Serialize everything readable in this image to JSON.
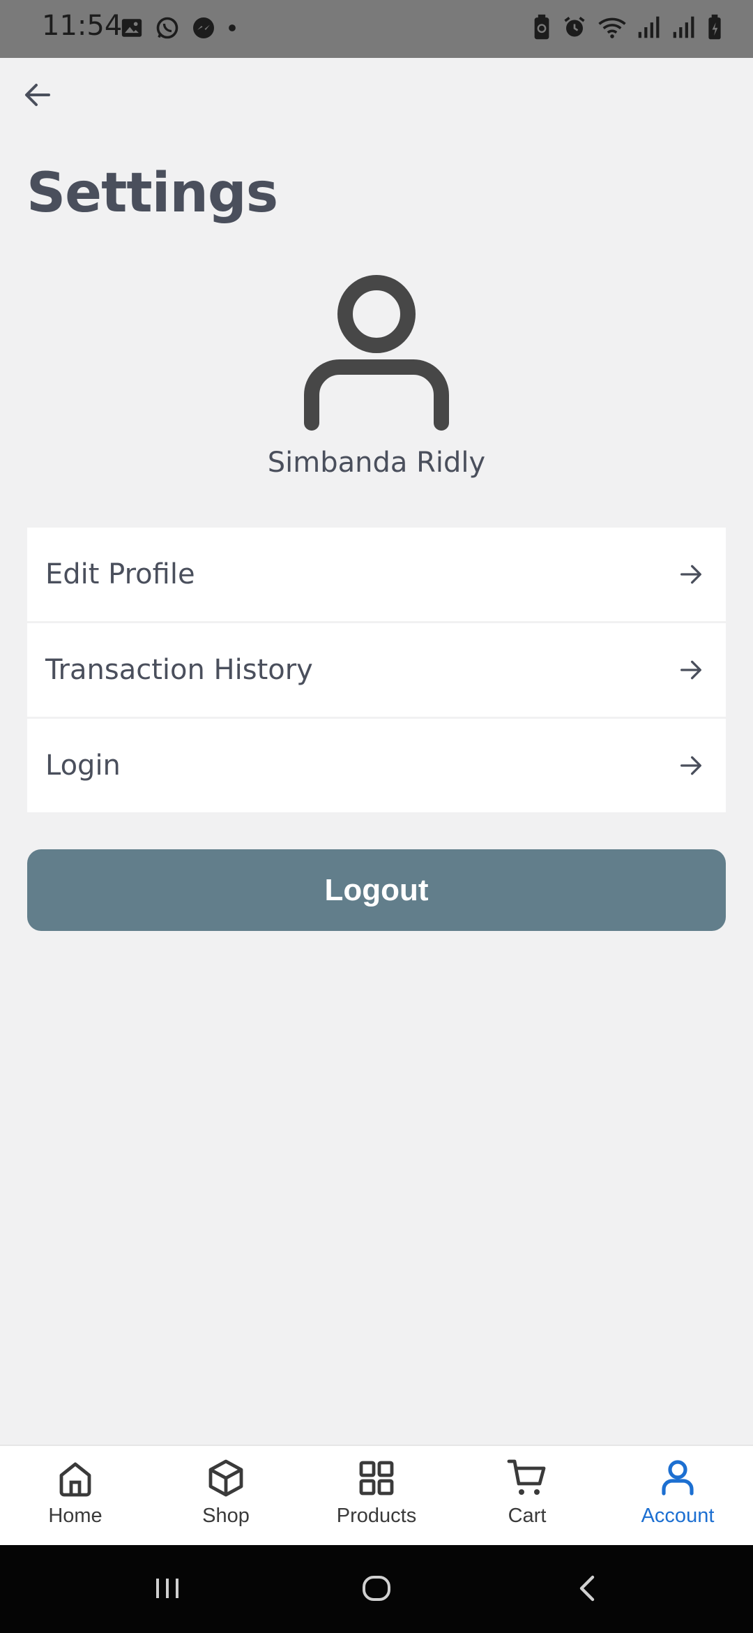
{
  "status_bar": {
    "time": "11:54",
    "left_icons": [
      "image-icon",
      "whatsapp-icon",
      "messenger-icon",
      "dot-icon"
    ],
    "right_icons": [
      "battery-saver-icon",
      "alarm-icon",
      "wifi-icon",
      "signal-icon",
      "signal-icon",
      "battery-charging-icon"
    ]
  },
  "header": {
    "back_icon": "arrow-left-icon",
    "title": "Settings"
  },
  "profile": {
    "avatar_icon": "user-icon",
    "name": "Simbanda Ridly"
  },
  "menu": {
    "items": [
      {
        "label": "Edit Profile",
        "icon": "arrow-right-icon"
      },
      {
        "label": "Transaction History",
        "icon": "arrow-right-icon"
      },
      {
        "label": "Login",
        "icon": "arrow-right-icon"
      }
    ]
  },
  "logout_label": "Logout",
  "bottom_nav": {
    "items": [
      {
        "label": "Home",
        "icon": "home-icon",
        "active": false
      },
      {
        "label": "Shop",
        "icon": "box-icon",
        "active": false
      },
      {
        "label": "Products",
        "icon": "grid-icon",
        "active": false
      },
      {
        "label": "Cart",
        "icon": "cart-icon",
        "active": false
      },
      {
        "label": "Account",
        "icon": "user-icon",
        "active": true
      }
    ]
  },
  "system_nav": {
    "icons": [
      "recents-icon",
      "home-circle-icon",
      "back-chevron-icon"
    ]
  },
  "colors": {
    "background": "#f1f1f2",
    "title_text": "#4a4f5c",
    "logout_button": "#627e8b",
    "active_nav": "#1c6fd1",
    "status_bar": "#7a7a7a"
  }
}
